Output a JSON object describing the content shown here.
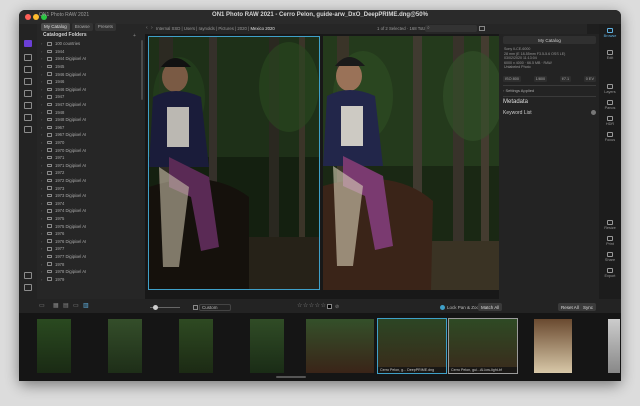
{
  "window": {
    "title": "ON1 Photo RAW 2021 - Cerro Pelon, guide-arw_DxO_DeepPRIME.dng@50%"
  },
  "app": {
    "name": "ON1 Photo RAW 2021"
  },
  "tabs": [
    {
      "label": "My Catalog",
      "active": true
    },
    {
      "label": "Browse",
      "active": false
    },
    {
      "label": "Presets",
      "active": false
    }
  ],
  "catalog": {
    "section_title": "Cataloged Folders",
    "folders": [
      "100 countries",
      "1944",
      "1944 Digipixel AI",
      "1945",
      "1946 Digipixel AI",
      "1946",
      "1946 Digipixel AI",
      "1947",
      "1947 Digipixel AI",
      "1948",
      "1948 Digipixel AI",
      "1967",
      "1967 Digipixel AI",
      "1970",
      "1970 Digipixel AI",
      "1971",
      "1971 Digipixel AI",
      "1972",
      "1972 Digipixel AI",
      "1973",
      "1973 Digipixel AI",
      "1974",
      "1974 Digipixel AI",
      "1975",
      "1975 Digipixel AI",
      "1976",
      "1976 Digipixel AI",
      "1977",
      "1977 Digipixel AI",
      "1978",
      "1978 Digipixel AI",
      "1979"
    ]
  },
  "breadcrumb": {
    "path": "Internal SSD | Users | raynolds | Pictures | 2020 |",
    "current": "Mexico 2020"
  },
  "selection": {
    "text": "1 of 2 Selected · 168 Total"
  },
  "info_panel": {
    "header": "My Catalog",
    "lines": [
      "Sony ILCE-6000",
      "28 mm (E 18-55mm F3.5-5.6 OSS LE)",
      "03/02/2020 11:13:04",
      "6000 x 4000 · 66.5 MB · RAW",
      "Unlabeled Photo"
    ],
    "exif": [
      "ISO 800",
      "1/800",
      "f/7.1",
      "0 EV"
    ],
    "settings_applied": "Settings Applied",
    "metadata_title": "Metadata",
    "keyword_list": "Keyword List"
  },
  "modules": [
    {
      "label": "Browse",
      "icon": "browse-icon",
      "active": true
    },
    {
      "label": "Edit",
      "icon": "edit-icon",
      "active": false
    },
    {
      "label": "Layers",
      "icon": "layers-icon",
      "active": false
    },
    {
      "label": "Panos",
      "icon": "panos-icon",
      "active": false
    },
    {
      "label": "HDR",
      "icon": "hdr-icon",
      "active": false
    },
    {
      "label": "Focus",
      "icon": "focus-icon",
      "active": false
    },
    {
      "label": "Resize",
      "icon": "resize-icon",
      "active": false
    },
    {
      "label": "Print",
      "icon": "print-icon",
      "active": false
    },
    {
      "label": "Share",
      "icon": "share-icon",
      "active": false
    },
    {
      "label": "Export",
      "icon": "export-icon",
      "active": false
    }
  ],
  "toolbar": {
    "custom_label": "Custom",
    "lock_label": "Lock Pan & Zoom",
    "match_label": "Match All",
    "reset_label": "Reset All",
    "sync_label": "Sync"
  },
  "filmstrip": {
    "thumbs": [
      {
        "caption": ""
      },
      {
        "caption": ""
      },
      {
        "caption": ""
      },
      {
        "caption": ""
      },
      {
        "caption": ""
      },
      {
        "caption": "Cerro Pelon, g... DeepPRIME.dng"
      },
      {
        "caption": "Cerro Pelon, gui...AI-low-light-bf"
      },
      {
        "caption": ""
      },
      {
        "caption": ""
      }
    ]
  },
  "colors": {
    "accent": "#3fa0c8",
    "active_module": "#5fb0e0",
    "app_icon": "#6b3fd6"
  }
}
